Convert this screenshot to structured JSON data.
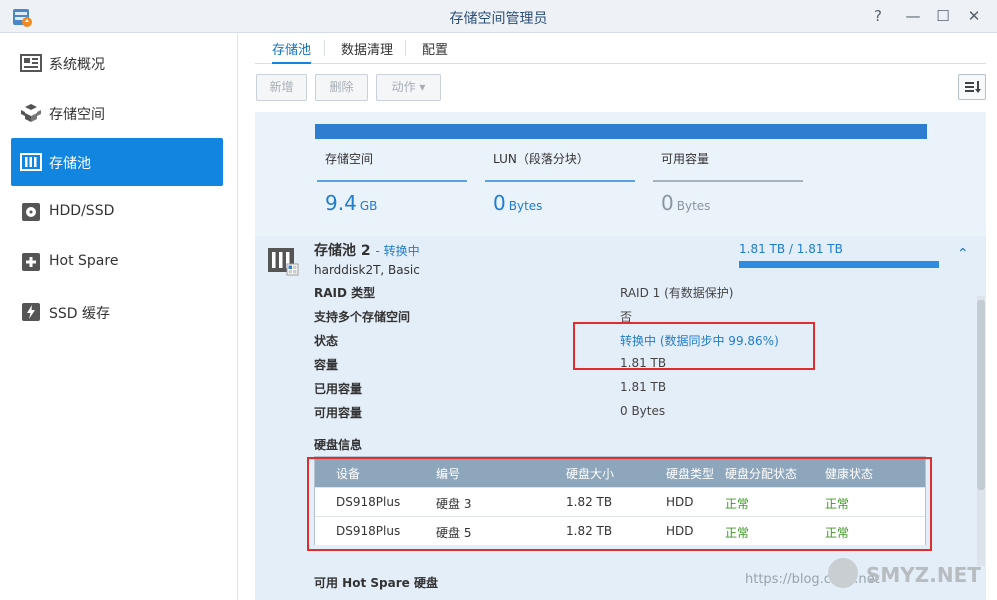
{
  "window": {
    "title": "存储空间管理员",
    "help_label": "?",
    "minimize_label": "—",
    "maximize_label": "☐",
    "close_label": "✕"
  },
  "sidebar": {
    "items": [
      {
        "label": "系统概况",
        "icon": "overview-icon",
        "active": false
      },
      {
        "label": "存储空间",
        "icon": "volume-cube-icon",
        "active": false
      },
      {
        "label": "存储池",
        "icon": "storage-pool-icon",
        "active": true
      },
      {
        "label": "HDD/SSD",
        "icon": "hdd-icon",
        "active": false
      },
      {
        "label": "Hot Spare",
        "icon": "hot-spare-plus-icon",
        "active": false
      },
      {
        "label": "SSD 缓存",
        "icon": "ssd-cache-bolt-icon",
        "active": false
      }
    ]
  },
  "tabs": [
    {
      "label": "存储池",
      "active": true
    },
    {
      "label": "数据清理",
      "active": false
    },
    {
      "label": "配置",
      "active": false
    }
  ],
  "toolbar": {
    "add_label": "新增",
    "delete_label": "删除",
    "action_label": "动作 ▾"
  },
  "summary": {
    "stats": [
      {
        "label": "存储空间",
        "value": "9.4",
        "unit": "GB"
      },
      {
        "label": "LUN（段落分块）",
        "value": "0",
        "unit": "Bytes"
      },
      {
        "label": "可用容量",
        "value": "0",
        "unit": "Bytes"
      }
    ]
  },
  "pool": {
    "name": "存储池 2",
    "status_prefix": "- ",
    "status": "转换中",
    "subtitle": "harddisk2T, Basic",
    "capacity_text": "1.81 TB / 1.81 TB",
    "capacity_fraction": 1.0,
    "collapse_glyph": "⌃",
    "details": [
      {
        "key": "RAID 类型",
        "value": "RAID 1 (有数据保护)",
        "link": false
      },
      {
        "key": "支持多个存储空间",
        "value": "否",
        "link": false
      },
      {
        "key": "状态",
        "value": "转换中 (数据同步中 99.86%)",
        "link": true
      },
      {
        "key": "容量",
        "value": "1.81 TB",
        "link": false
      },
      {
        "key": "已用容量",
        "value": "1.81 TB",
        "link": false
      },
      {
        "key": "可用容量",
        "value": "0 Bytes",
        "link": false
      }
    ],
    "disk_section_title": "硬盘信息",
    "disk_table": {
      "headers": [
        "设备",
        "编号",
        "硬盘大小",
        "硬盘类型",
        "硬盘分配状态",
        "健康状态"
      ],
      "rows": [
        [
          "DS918Plus",
          "硬盘 3",
          "1.82 TB",
          "HDD",
          "正常",
          "正常"
        ],
        [
          "DS918Plus",
          "硬盘 5",
          "1.82 TB",
          "HDD",
          "正常",
          "正常"
        ]
      ]
    },
    "hot_spare_title": "可用 Hot Spare 硬盘"
  },
  "watermark": {
    "url_text": "https://blog.csdn.net",
    "brand_text": "SMYZ.NET"
  },
  "colors": {
    "accent": "#1185e0",
    "panel_bg": "#eaf2fa",
    "ok_green": "#3c9a23",
    "annotation_red": "#e02e2e"
  }
}
